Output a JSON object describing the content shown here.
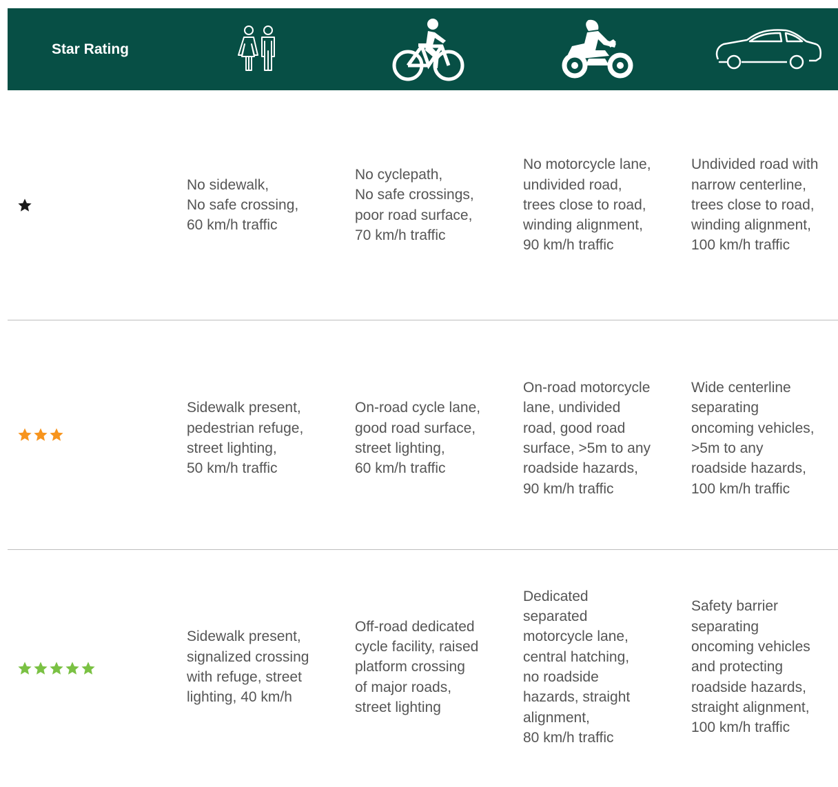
{
  "header": {
    "label": "Star Rating",
    "icons": [
      "pedestrian-icon",
      "cyclist-icon",
      "motorcyclist-icon",
      "car-icon"
    ]
  },
  "colors": {
    "header_bg": "#074f45",
    "one_star": "#1a1a1a",
    "three_star": "#f7941d",
    "five_star": "#7ac143"
  },
  "rows": [
    {
      "stars": 1,
      "cells": [
        "No sidewalk,\nNo safe crossing,\n60 km/h traffic",
        "No cyclepath,\nNo safe crossings,\npoor road surface,\n70 km/h traffic",
        "No motorcycle lane,\nundivided road,\ntrees close to road,\nwinding alignment,\n90 km/h traffic",
        "Undivided road with\nnarrow centerline,\ntrees close to road,\nwinding alignment,\n100 km/h traffic"
      ]
    },
    {
      "stars": 3,
      "cells": [
        "Sidewalk present,\npedestrian refuge,\nstreet lighting,\n50 km/h traffic",
        "On-road cycle lane,\ngood road surface,\nstreet lighting,\n60 km/h traffic",
        "On-road motorcycle\nlane, undivided\nroad, good road\nsurface, >5m to any\nroadside hazards,\n90 km/h traffic",
        "Wide centerline\nseparating\noncoming vehicles,\n>5m to any\nroadside hazards,\n100 km/h traffic"
      ]
    },
    {
      "stars": 5,
      "cells": [
        "Sidewalk present,\nsignalized crossing\nwith refuge, street\nlighting, 40 km/h",
        "Off-road dedicated\ncycle facility, raised\nplatform crossing\nof major roads,\nstreet lighting",
        "Dedicated\nseparated\nmotorcycle lane,\ncentral hatching,\nno roadside\nhazards, straight\nalignment,\n80 km/h traffic",
        "Safety barrier\nseparating\noncoming vehicles\nand protecting\nroadside hazards,\nstraight alignment,\n100 km/h traffic"
      ]
    }
  ]
}
